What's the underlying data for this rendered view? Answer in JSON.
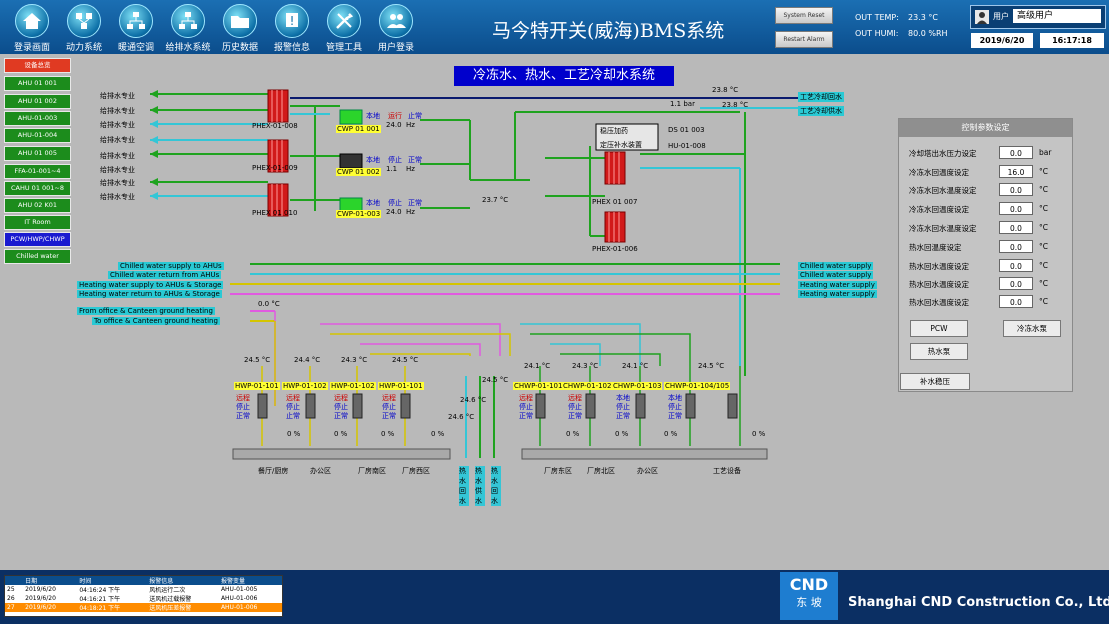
{
  "app": {
    "title": "马今特开关(威海)BMS系统",
    "out_temp_label": "OUT TEMP:",
    "out_temp_value": "23.3 °C",
    "out_humi_label": "OUT HUMI:",
    "out_humi_value": "80.0 %RH",
    "user_label": "用户",
    "user_value": "高级用户",
    "date": "2019/6/20",
    "time": "16:17:18",
    "small_btn_1": "System Reset",
    "small_btn_2": "Restart Alarm"
  },
  "nav": [
    {
      "label": "登录画面",
      "icon": "home-icon"
    },
    {
      "label": "动力系统",
      "icon": "power-system-icon"
    },
    {
      "label": "暖通空调",
      "icon": "hvac-network-icon"
    },
    {
      "label": "给排水系统",
      "icon": "water-system-icon"
    },
    {
      "label": "历史数据",
      "icon": "folder-icon"
    },
    {
      "label": "报警信息",
      "icon": "alarm-icon"
    },
    {
      "label": "管理工具",
      "icon": "tools-icon"
    },
    {
      "label": "用户登录",
      "icon": "users-icon"
    }
  ],
  "sidebar": {
    "header": "设备总览",
    "items": [
      "AHU 01 001",
      "AHU 01 002",
      "AHU-01-003",
      "AHU-01-004",
      "AHU 01 005",
      "FFA-01-001~4",
      "CAHU 01 001~8",
      "AHU 02 K01",
      "IT Room",
      "PCW/HWP/CHWP",
      "Chilled water"
    ]
  },
  "schematic": {
    "title": "冷冻水、热水、工艺冷却水系统",
    "left_labels": [
      "给排水专业",
      "给排水专业",
      "给排水专业",
      "给排水专业",
      "给排水专业",
      "给排水专业",
      "给排水专业",
      "给排水专业",
      "给排水专业"
    ],
    "phex": [
      "PHEX-01-008",
      "PHEX-01-009",
      "PHEX 01 010",
      "PHEX 01 007",
      "PHEX-01-006"
    ],
    "cwp": [
      {
        "id": "CWP 01 001",
        "mode": "本地",
        "state": "运行",
        "cmd": "止常",
        "value": "24.0",
        "unit": "Hz"
      },
      {
        "id": "CWP 01 002",
        "mode": "本地",
        "state": "停止",
        "cmd": "正常",
        "value": "1.1",
        "unit": "Hz"
      },
      {
        "id": "CWP-01-003",
        "mode": "本地",
        "state": "停止",
        "cmd": "正常",
        "value": "24.0",
        "unit": "Hz"
      }
    ],
    "ds_box": {
      "line1": "稳压加药",
      "line2": "定压补水装置",
      "id1": "DS 01 003",
      "id2": "HU-01-008"
    },
    "top_right": {
      "t1": "23.8 °C",
      "t2": "23.8 °C",
      "pressure": "1.1 bar",
      "label1": "工艺冷却回水",
      "label2": "工艺冷却供水"
    },
    "mid_temp": "23.7 °C",
    "supply_lines_left": [
      "Chilled water supply to AHUs",
      "Chilled water return from AHUs",
      "Heating water supply to AHUs & Storage",
      "Heating water return to AHUs & Storage",
      "From office & Canteen ground heating",
      "To office & Canteen ground heating"
    ],
    "supply_lines_right": [
      "Chilled water supply",
      "Chilled water supply",
      "Heating water supply",
      "Heating water supply"
    ],
    "office_temp": "0.0 °C",
    "hwp": [
      {
        "id": "HWP-01-101",
        "temp": "24.5 °C",
        "s1": "远程",
        "s2": "停止",
        "s3": "正常",
        "pct": "0 %"
      },
      {
        "id": "HWP-01-102",
        "temp": "24.4 °C",
        "s1": "远程",
        "s2": "停止",
        "s3": "止常",
        "pct": "0 %"
      },
      {
        "id": "HWP-01-102",
        "temp": "24.3 °C",
        "s1": "远程",
        "s2": "停止",
        "s3": "正常",
        "pct": "0 %"
      },
      {
        "id": "HWP-01-101",
        "temp": "24.5 °C",
        "s1": "远程",
        "s2": "停止",
        "s3": "正常",
        "pct": "0 %"
      }
    ],
    "center_temps": [
      "24.5 °C",
      "24.6 °C",
      "24.6 °C"
    ],
    "chwp": [
      {
        "id": "CHWP-01-101",
        "temp": "24.1 °C",
        "s1": "远程",
        "s2": "停止",
        "s3": "正常",
        "pct": "0 %"
      },
      {
        "id": "CHWP-01-102",
        "temp": "24.3 °C",
        "s1": "远程",
        "s2": "停止",
        "s3": "正常",
        "pct": "0 %"
      },
      {
        "id": "CHWP-01-103",
        "temp": "24.1 °C",
        "s1": "本地",
        "s2": "停止",
        "s3": "正常",
        "pct": "0 %"
      },
      {
        "id": "CHWP-01-104/105",
        "temp": "24.5 °C",
        "s1": "本地",
        "s2": "停止",
        "s3": "正常",
        "pct": "0 %"
      }
    ],
    "headers_left": [
      "餐厅/厨房",
      "办公区",
      "厂房南区",
      "厂房西区"
    ],
    "headers_center": [
      "热水回水",
      "热水供水",
      "热水回水"
    ],
    "headers_right": [
      "厂房东区",
      "厂房北区",
      "办公区",
      "工艺设备"
    ]
  },
  "settings": {
    "header": "控制参数设定",
    "rows": [
      {
        "label": "冷却塔出水压力设定",
        "value": "0.0",
        "unit": "bar"
      },
      {
        "label": "冷冻水回温度设定",
        "value": "16.0",
        "unit": "°C"
      },
      {
        "label": "冷冻水回水温度设定",
        "value": "0.0",
        "unit": "°C"
      },
      {
        "label": "冷冻水回温度设定",
        "value": "0.0",
        "unit": "°C"
      },
      {
        "label": "冷冻水回水温度设定",
        "value": "0.0",
        "unit": "°C"
      },
      {
        "label": "热水回温度设定",
        "value": "0.0",
        "unit": "°C"
      },
      {
        "label": "热水回水温度设定",
        "value": "0.0",
        "unit": "°C"
      },
      {
        "label": "热水回水温度设定",
        "value": "0.0",
        "unit": "°C"
      },
      {
        "label": "热水回水温度设定",
        "value": "0.0",
        "unit": "°C"
      }
    ],
    "btn_pcw": "PCW",
    "btn_cold": "冷冻水泵",
    "btn_hot": "热水泵",
    "btn_makeup": "补水稳压"
  },
  "alarm": {
    "headers": [
      "",
      "日期",
      "时间",
      "报警信息",
      "报警变量"
    ],
    "rows": [
      {
        "no": "25",
        "date": "2019/6/20",
        "time": "04:16:24 下午",
        "msg": "风机运行二次",
        "tag": "AHU-01-005"
      },
      {
        "no": "26",
        "date": "2019/6/20",
        "time": "04:16:21 下午",
        "msg": "送风机过载报警",
        "tag": "AHU-01-006"
      },
      {
        "no": "27",
        "date": "2019/6/20",
        "time": "04:18:21 下午",
        "msg": "送风机压差报警",
        "tag": "AHU-01-006"
      }
    ]
  },
  "footer": {
    "logo_top": "CND",
    "logo_bottom": "东 坡",
    "company": "Shanghai CND Construction Co., Ltd"
  }
}
